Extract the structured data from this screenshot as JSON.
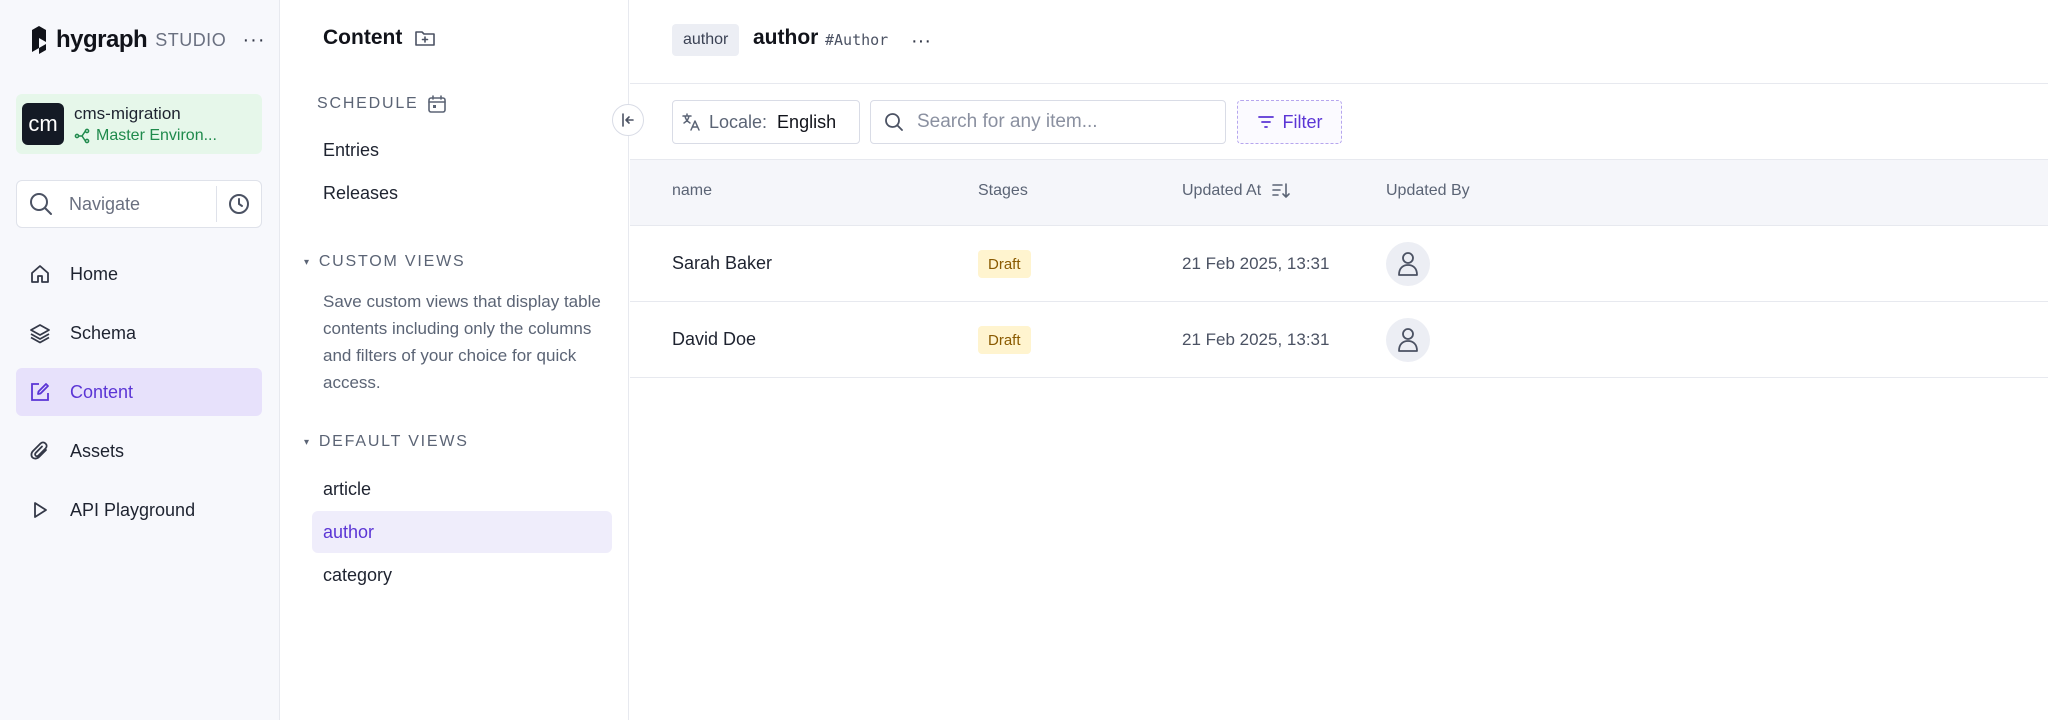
{
  "brand": {
    "name": "hygraph",
    "suffix": "STUDIO",
    "more_label": "···"
  },
  "project": {
    "avatar_text": "cm",
    "name": "cms-migration",
    "environment": "Master Environ..."
  },
  "navigate": {
    "label": "Navigate"
  },
  "nav": {
    "items": [
      {
        "label": "Home",
        "icon": "home-icon",
        "active": false
      },
      {
        "label": "Schema",
        "icon": "layers-icon",
        "active": false
      },
      {
        "label": "Content",
        "icon": "edit-icon",
        "active": true
      },
      {
        "label": "Assets",
        "icon": "paperclip-icon",
        "active": false
      },
      {
        "label": "API Playground",
        "icon": "play-icon",
        "active": false
      }
    ]
  },
  "content_panel": {
    "title": "Content",
    "schedule": {
      "label": "SCHEDULE",
      "items": [
        "Entries",
        "Releases"
      ]
    },
    "custom_views": {
      "label": "CUSTOM VIEWS",
      "description": "Save custom views that display table contents including only the columns and filters of your choice for quick access."
    },
    "default_views": {
      "label": "DEFAULT VIEWS",
      "items": [
        "article",
        "author",
        "category"
      ],
      "active": "author"
    }
  },
  "header": {
    "model_chip": "author",
    "model_name": "author",
    "api_id": "#Author",
    "more_label": "···"
  },
  "toolbar": {
    "locale_label": "Locale:",
    "locale_value": "English",
    "search_placeholder": "Search for any item...",
    "filter_label": "Filter"
  },
  "table": {
    "columns": [
      "name",
      "Stages",
      "Updated At",
      "Updated By"
    ],
    "rows": [
      {
        "name": "Sarah Baker",
        "stage": "Draft",
        "updated_at": "21 Feb 2025, 13:31"
      },
      {
        "name": "David Doe",
        "stage": "Draft",
        "updated_at": "21 Feb 2025, 13:31"
      }
    ]
  },
  "colors": {
    "accent": "#5b35d5",
    "active_bg": "#e7e1fb",
    "env_green": "#1f8a4c",
    "draft_bg": "#fff4cf",
    "draft_text": "#8a5a00"
  }
}
